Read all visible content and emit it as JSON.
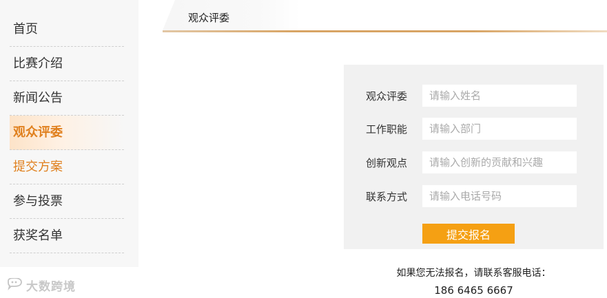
{
  "sidebar": {
    "items": [
      {
        "label": "首页"
      },
      {
        "label": "比赛介绍"
      },
      {
        "label": "新闻公告"
      },
      {
        "label": "观众评委"
      },
      {
        "label": "提交方案"
      },
      {
        "label": "参与投票"
      },
      {
        "label": "获奖名单"
      }
    ],
    "active_index": 3
  },
  "tab": {
    "label": "观众评委"
  },
  "form": {
    "fields": [
      {
        "label": "观众评委",
        "placeholder": "请输入姓名",
        "value": ""
      },
      {
        "label": "工作职能",
        "placeholder": "请输入部门",
        "value": ""
      },
      {
        "label": "创新观点",
        "placeholder": "请输入创新的贡献和兴趣",
        "value": ""
      },
      {
        "label": "联系方式",
        "placeholder": "请输入电话号码",
        "value": ""
      }
    ],
    "submit_label": "提交报名"
  },
  "contact": {
    "note": "如果您无法报名，请联系客服电话：",
    "phone": "186 6465 6667"
  },
  "watermark": {
    "text": "大数跨境",
    "icon": "speech-bubble-logo-icon"
  },
  "colors": {
    "accent": "#e0801e",
    "button": "#f5a013",
    "panel": "#f1f1f1",
    "sidebar": "#f7f7f7"
  }
}
